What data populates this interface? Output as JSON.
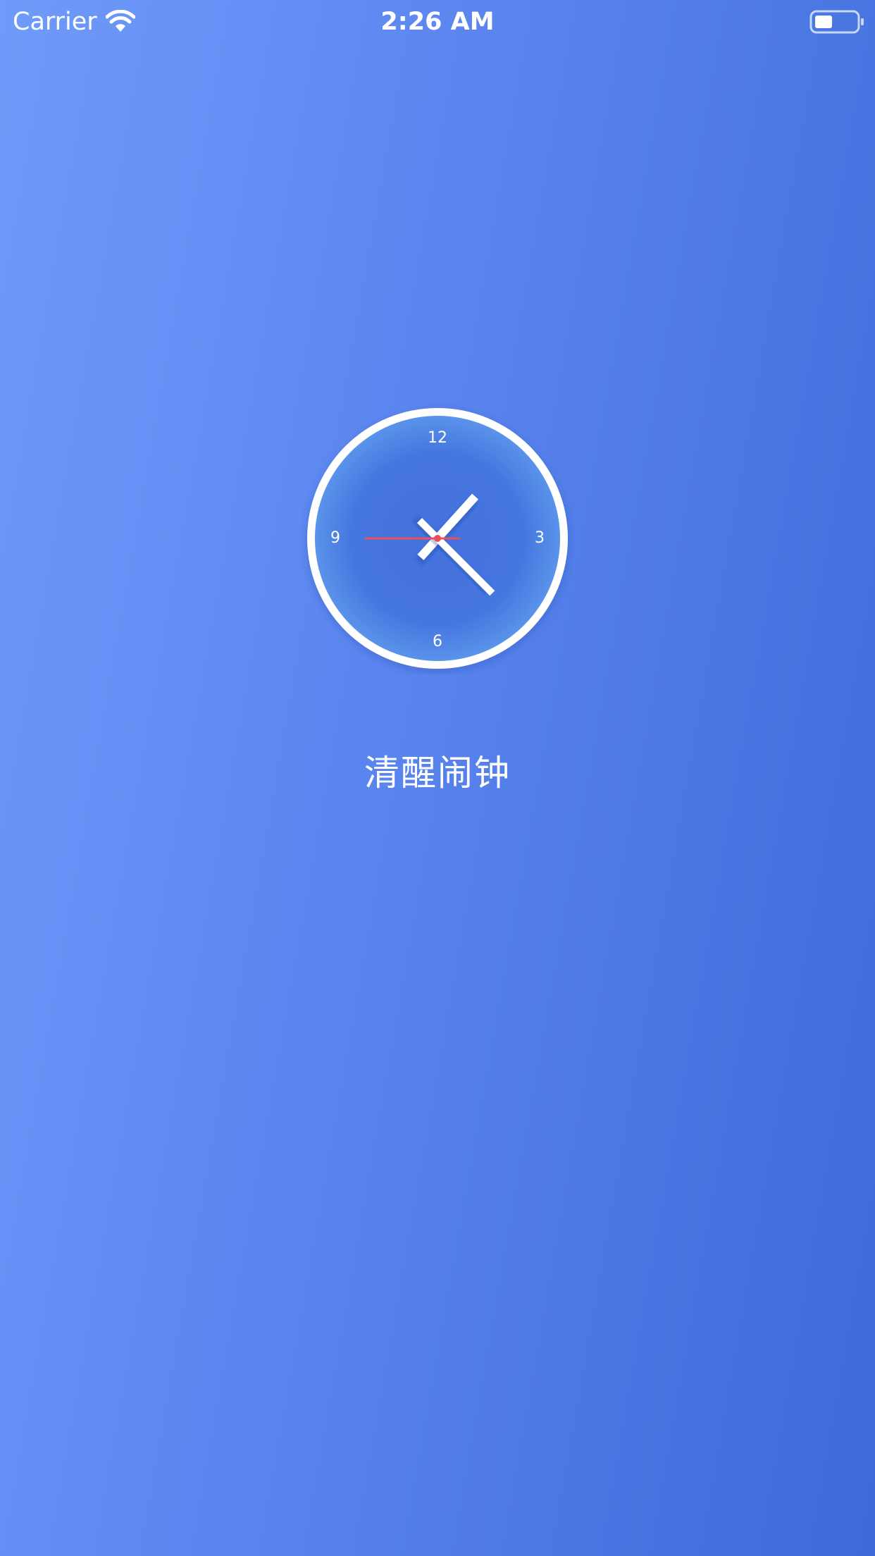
{
  "status_bar": {
    "carrier": "Carrier",
    "time": "2:26 AM",
    "wifi_icon": "wifi-icon",
    "battery_icon": "battery-icon"
  },
  "clock": {
    "numerals": {
      "twelve": "12",
      "three": "3",
      "six": "6",
      "nine": "9"
    },
    "hand_angles_deg": {
      "hour": 42,
      "minute": 135,
      "second": 270
    },
    "colors": {
      "face": "#4a78e0",
      "rim": "#ffffff",
      "hands": "#ffffff",
      "second_hand": "#e8505b"
    }
  },
  "app": {
    "title": "清醒闹钟"
  }
}
